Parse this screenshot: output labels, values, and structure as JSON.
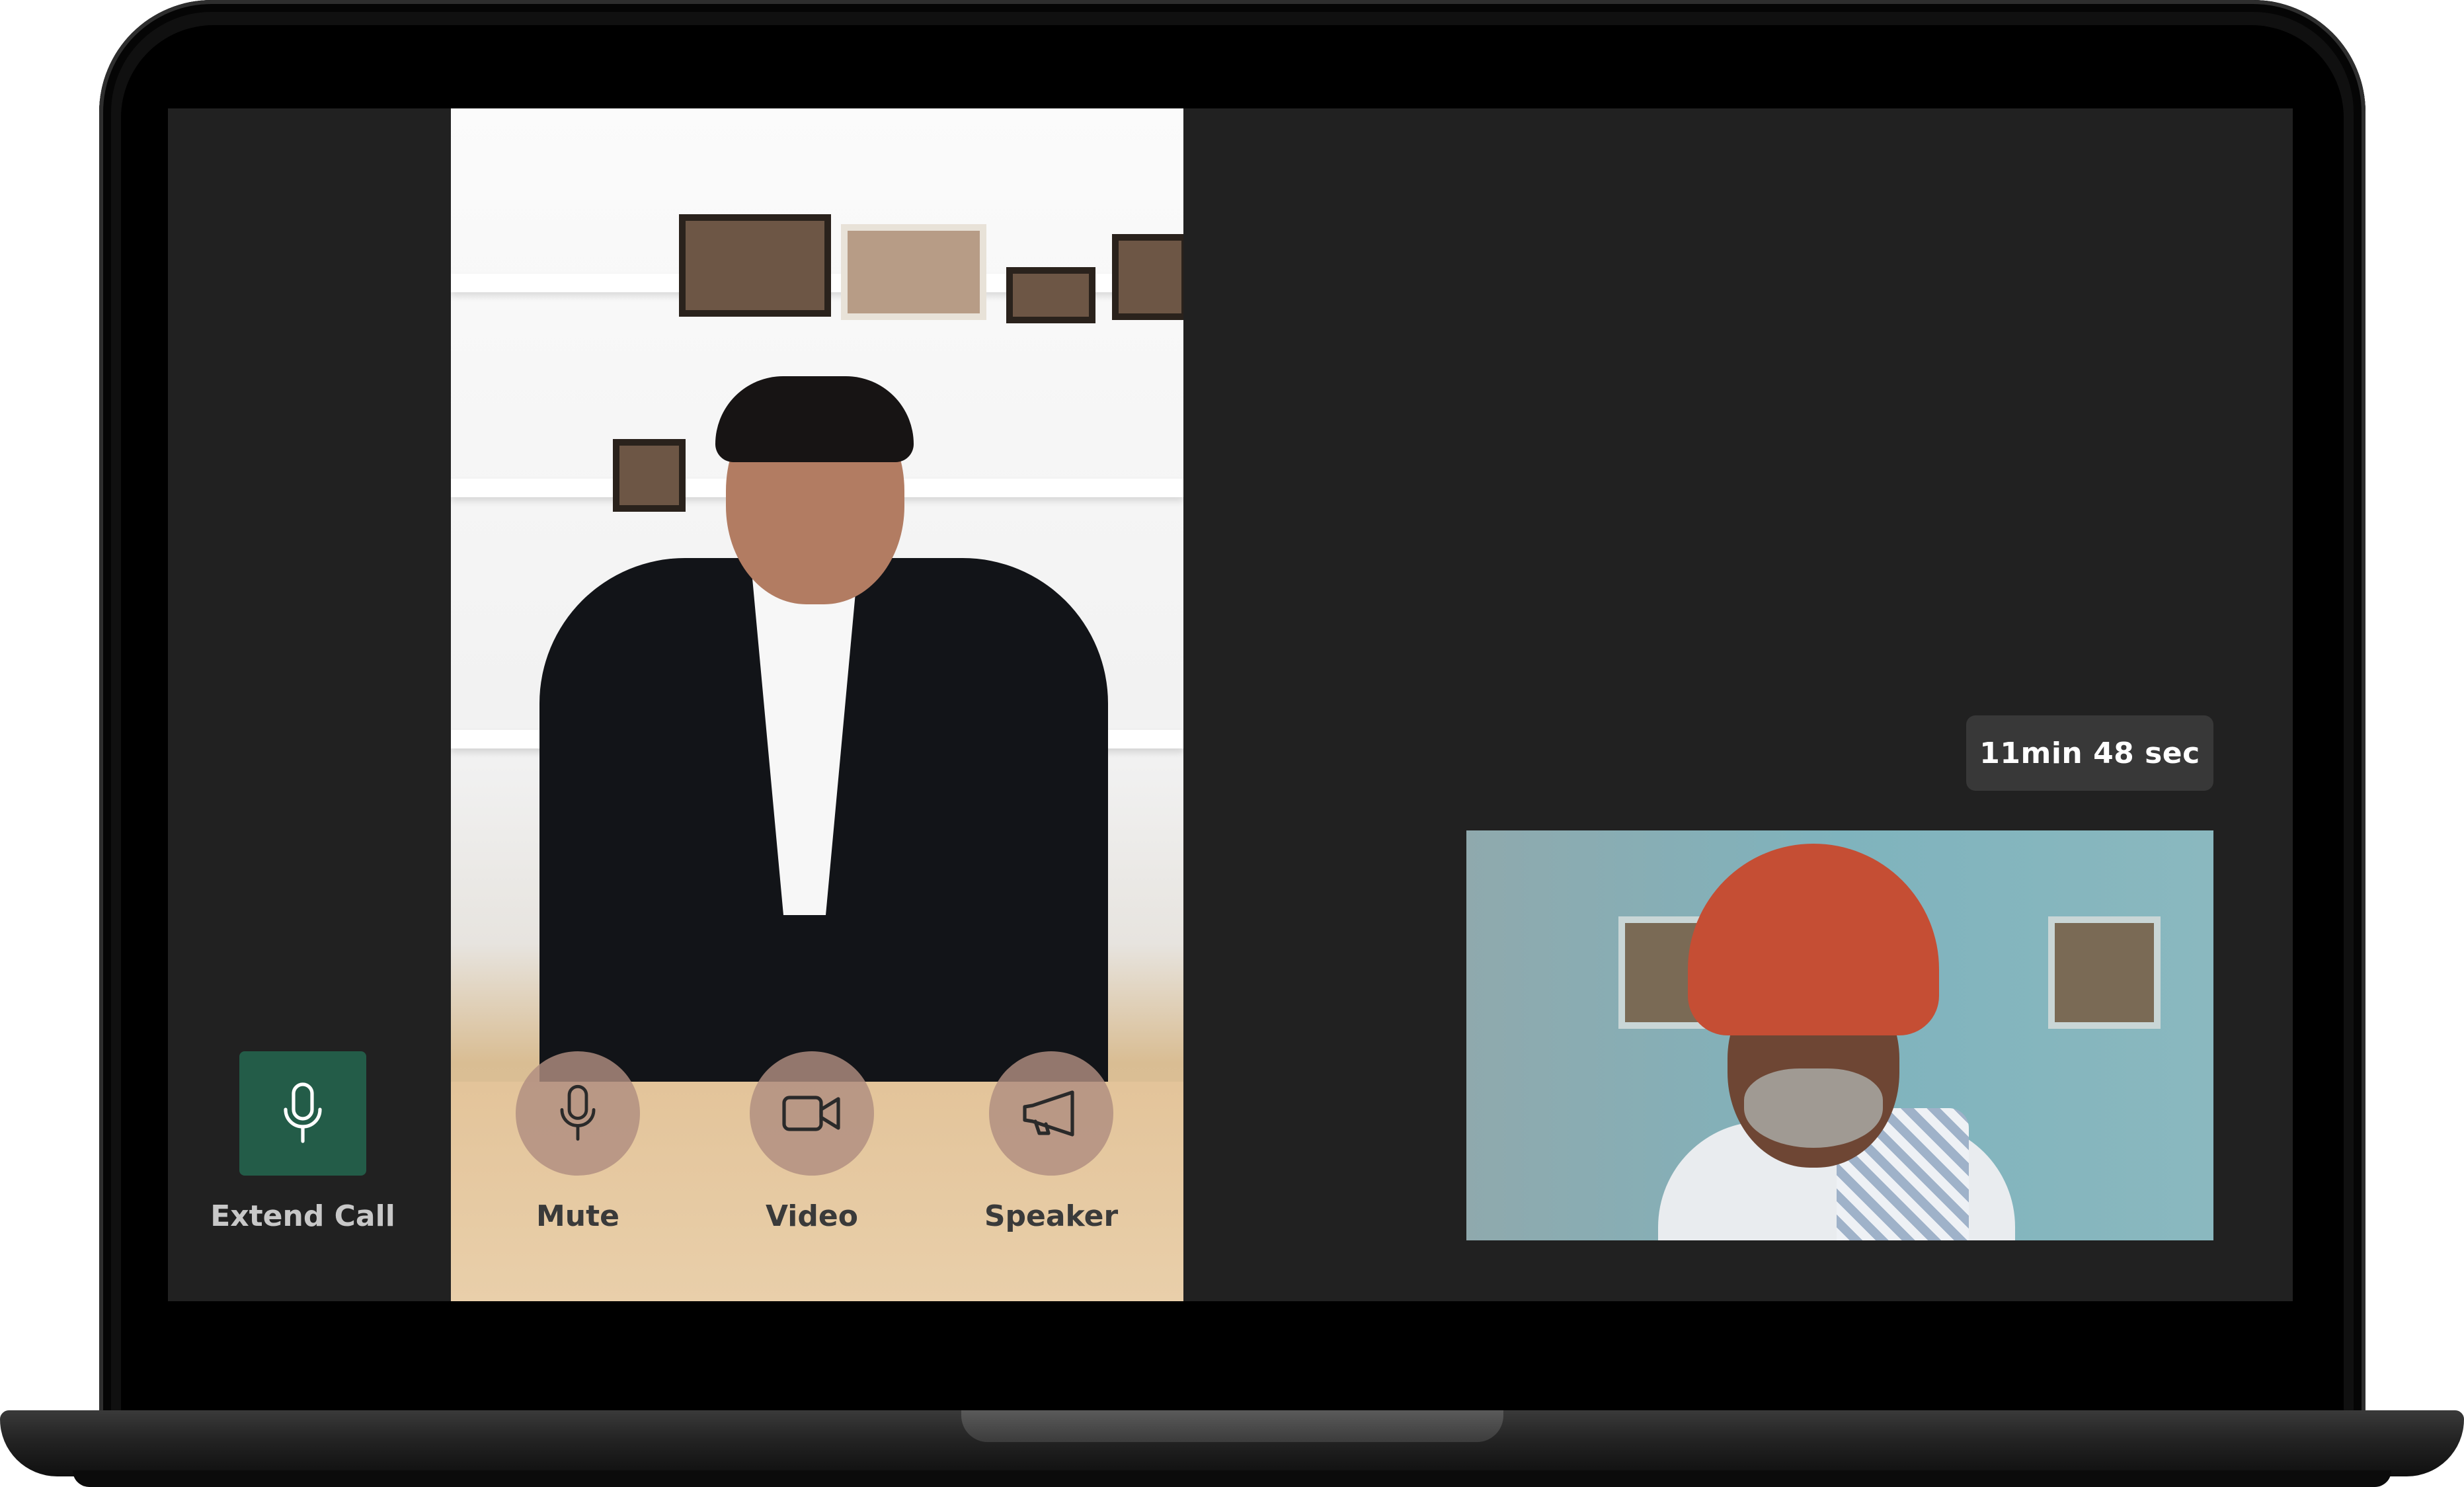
{
  "call": {
    "timer": "11min 48 sec"
  },
  "controls": {
    "extend_call": {
      "label": "Extend Call",
      "icon": "microphone-icon"
    },
    "mute": {
      "label": "Mute",
      "icon": "microphone-icon"
    },
    "video": {
      "label": "Video",
      "icon": "video-camera-icon"
    },
    "speaker": {
      "label": "Speaker",
      "icon": "megaphone-icon"
    }
  },
  "colors": {
    "screen_background": "#212121",
    "extend_call_button": "#235c48",
    "control_button": "#b08e80",
    "timer_background": "#383838"
  }
}
